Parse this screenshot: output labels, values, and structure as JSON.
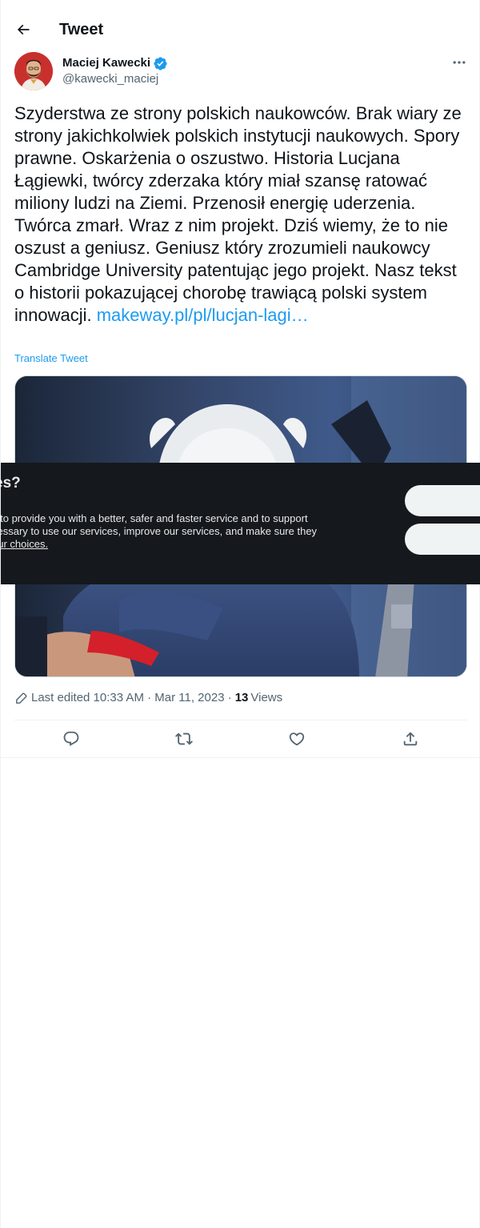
{
  "header": {
    "title": "Tweet",
    "back_icon": "arrow-left-icon"
  },
  "author": {
    "name": "Maciej Kawecki",
    "handle": "@kawecki_maciej",
    "verified": true,
    "verified_color": "#1d9bf0"
  },
  "tweet": {
    "text": "Szyderstwa ze strony polskich naukowców. Brak wiary ze strony jakichkolwiek polskich instytucji naukowych. Spory prawne. Oskarżenia o oszustwo. Historia Lucjana Łągiewki, twórcy zderzaka który miał szansę ratować miliony ludzi na Ziemi. Przenosił energię uderzenia. Twórca zmarł. Wraz z nim projekt. Dziś wiemy, że to nie oszust a geniusz. Geniusz który zrozumieli naukowcy Cambridge University patentując jego projekt. Nasz tekst o historii pokazującej chorobę trawiącą polski system innowacji. ",
    "link_text": "makeway.pl/pl/lucjan-lagi…",
    "translate_label": "Translate Tweet"
  },
  "cookie_banner": {
    "title_fragment": "es?",
    "body_lines": [
      "s to provide you with a better, safer and faster service and to support",
      "cessary to use our services, improve our services, and make sure they"
    ],
    "link_fragment": "our choices."
  },
  "meta": {
    "edited_label": "Last edited 10:33 AM · Mar 11, 2023 ·",
    "views_count": "13",
    "views_label": "Views"
  },
  "actions": {
    "reply_icon": "reply-icon",
    "retweet_icon": "retweet-icon",
    "like_icon": "heart-icon",
    "share_icon": "share-icon"
  },
  "colors": {
    "text": "#0f1419",
    "secondary": "#536471",
    "link": "#1d9bf0",
    "banner_bg": "#15181c",
    "border": "#eff3f4"
  }
}
